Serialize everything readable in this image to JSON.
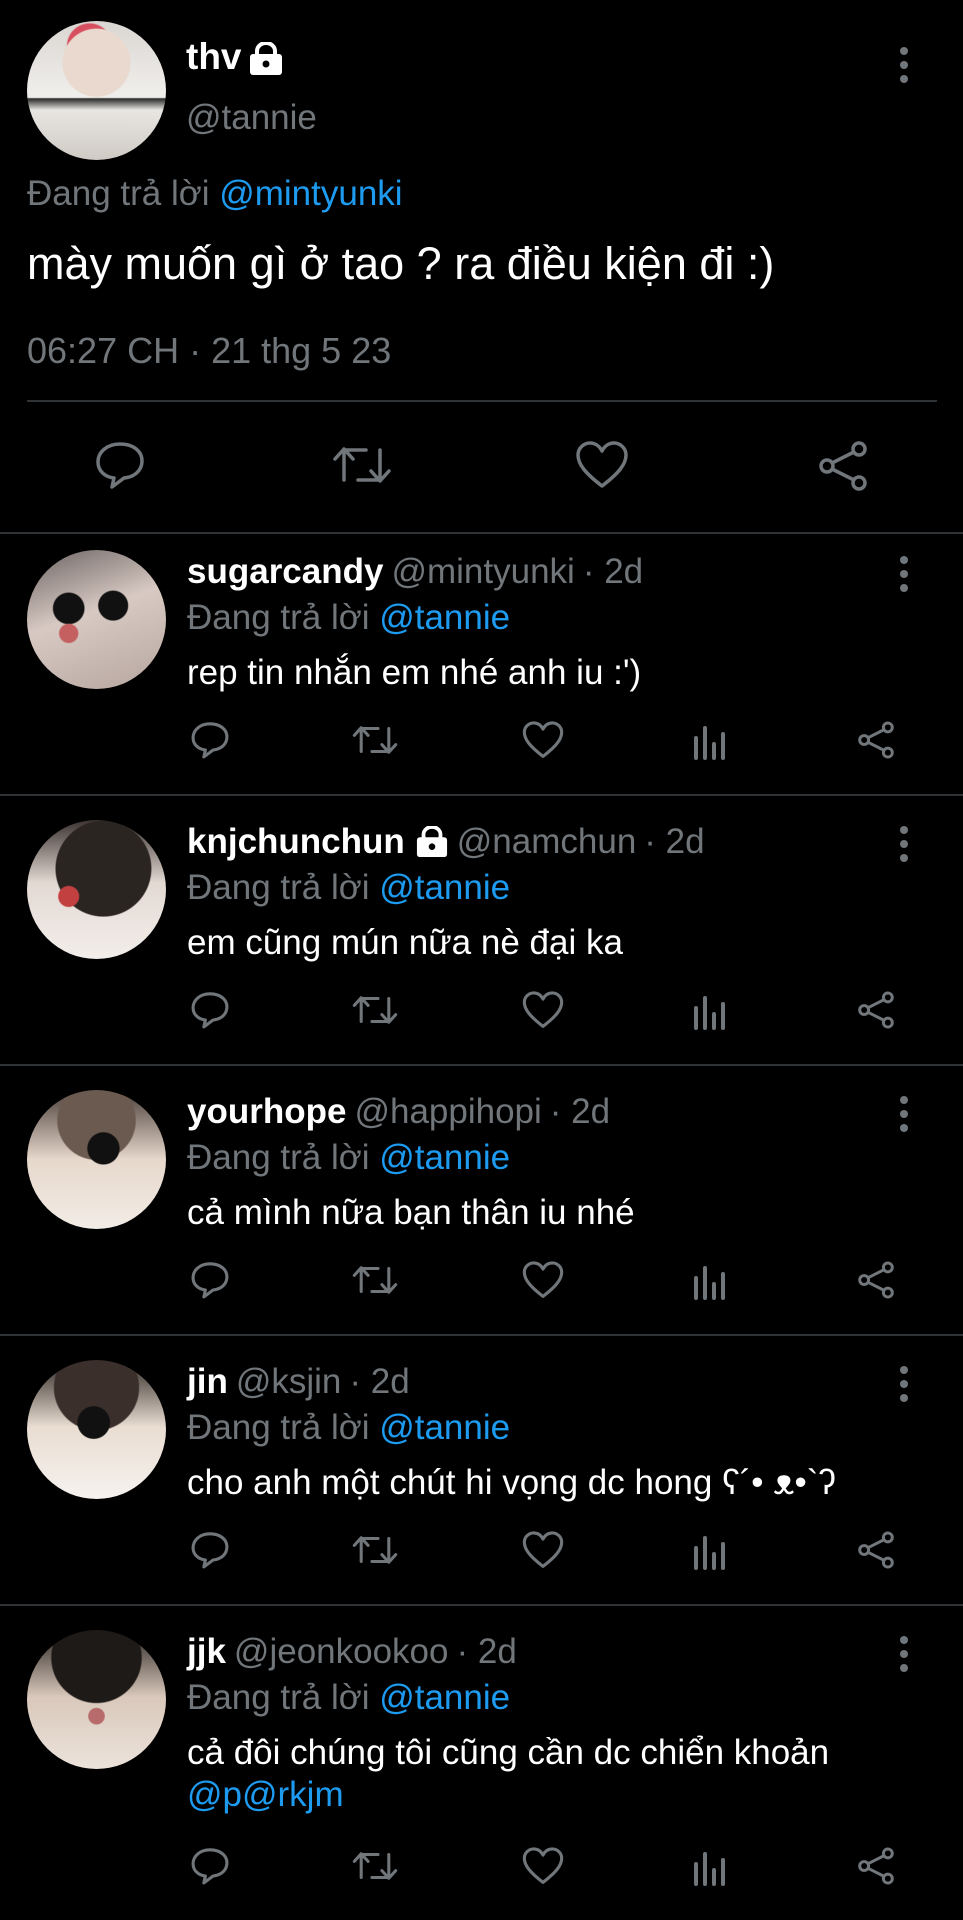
{
  "main_tweet": {
    "display_name": "thv",
    "handle": "@tannie",
    "reply_prefix": "Đang trả lời",
    "reply_mention": "@mintyunki",
    "text": "mày muốn gì ở tao ? ra điều kiện đi :)",
    "timestamp": "06:27 CH · 21 thg 5 23",
    "icons": [
      "reply-icon",
      "retweet-icon",
      "like-icon",
      "share-icon"
    ]
  },
  "replies": [
    {
      "display_name": "sugarcandy",
      "handle": "@mintyunki",
      "age": "· 2d",
      "locked": false,
      "reply_prefix": "Đang trả lời",
      "reply_mention": "@tannie",
      "text": "rep tin nhắn em nhé anh iu :')",
      "extra_mention": ""
    },
    {
      "display_name": "knjchunchun",
      "handle": "@namchun",
      "age": "· 2d",
      "locked": true,
      "reply_prefix": "Đang trả lời",
      "reply_mention": "@tannie",
      "text": "em cũng mún nữa nè đại ka",
      "extra_mention": ""
    },
    {
      "display_name": "yourhope",
      "handle": "@happihopi",
      "age": "· 2d",
      "locked": false,
      "reply_prefix": "Đang trả lời",
      "reply_mention": "@tannie",
      "text": "cả mình nữa bạn thân iu nhé",
      "extra_mention": ""
    },
    {
      "display_name": "jin",
      "handle": "@ksjin",
      "age": "· 2d",
      "locked": false,
      "reply_prefix": "Đang trả lời",
      "reply_mention": "@tannie",
      "text": "cho anh một chút hi vọng dc hong ʕ´• ᴥ•`ʔ",
      "extra_mention": ""
    },
    {
      "display_name": "jjk",
      "handle": "@jeonkookoo",
      "age": "· 2d",
      "locked": false,
      "reply_prefix": "Đang trả lời",
      "reply_mention": "@tannie",
      "text": "cả đôi chúng tôi cũng cần dc chiển khoản",
      "extra_mention": "@p@rkjm"
    }
  ],
  "colors": {
    "background": "#000000",
    "text": "#e7e9ea",
    "secondary": "#71767b",
    "accent": "#1d9bf0",
    "divider": "#2f3336"
  }
}
